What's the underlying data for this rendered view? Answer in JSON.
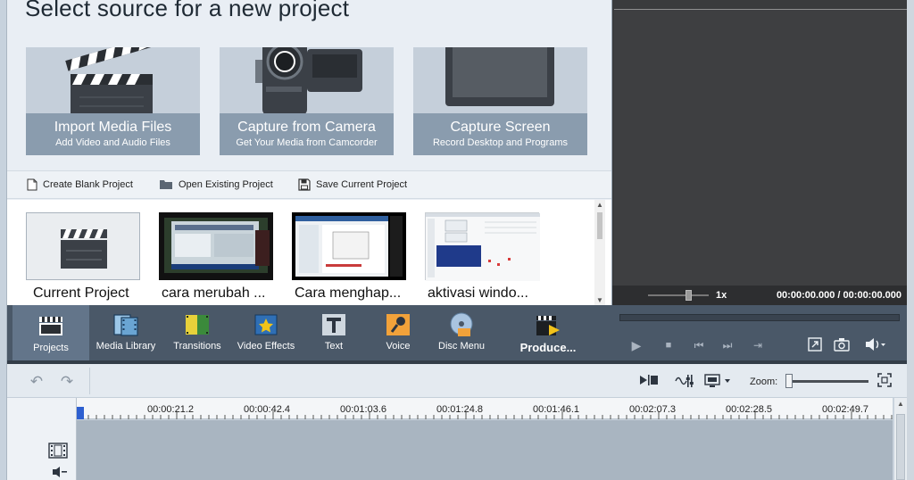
{
  "page_title": "Select source for a new project",
  "sources": [
    {
      "title": "Import Media Files",
      "subtitle": "Add Video and Audio Files",
      "icon": "clapperboard-icon"
    },
    {
      "title": "Capture from Camera",
      "subtitle": "Get Your Media from Camcorder",
      "icon": "camcorder-icon"
    },
    {
      "title": "Capture Screen",
      "subtitle": "Record Desktop and Programs",
      "icon": "monitor-icon"
    }
  ],
  "project_actions": [
    {
      "label": "Create Blank Project",
      "icon": "document-icon"
    },
    {
      "label": "Open Existing Project",
      "icon": "folder-icon"
    },
    {
      "label": "Save Current Project",
      "icon": "save-icon"
    }
  ],
  "recent_projects": [
    {
      "label": "Current Project"
    },
    {
      "label": "cara merubah ..."
    },
    {
      "label": "Cara menghap..."
    },
    {
      "label": "aktivasi windo..."
    }
  ],
  "preview": {
    "speed": "1x",
    "time": "00:00:00.000 / 00:00:00.000"
  },
  "toolbar": {
    "items": [
      {
        "label": "Projects",
        "icon": "clapperboard-icon",
        "active": true
      },
      {
        "label": "Media Library",
        "icon": "film-strip-icon"
      },
      {
        "label": "Transitions",
        "icon": "transitions-icon"
      },
      {
        "label": "Video Effects",
        "icon": "star-film-icon"
      },
      {
        "label": "Text",
        "icon": "text-t-icon"
      },
      {
        "label": "Voice",
        "icon": "microphone-icon"
      },
      {
        "label": "Disc Menu",
        "icon": "disc-icon"
      },
      {
        "label": "Produce...",
        "icon": "produce-icon"
      }
    ]
  },
  "timeline": {
    "zoom_label": "Zoom:",
    "ticks": [
      "00:00:21.2",
      "00:00:42.4",
      "00:01:03.6",
      "00:01:24.8",
      "00:01:46.1",
      "00:02:07.3",
      "00:02:28.5",
      "00:02:49.7"
    ]
  },
  "colors": {
    "toolbar_bg": "#4a5868",
    "caption_bg": "#8a9cae",
    "preview_bg": "#3a3b3d",
    "track_bg": "#a9b5c1",
    "playhead": "#2d5fd0"
  }
}
